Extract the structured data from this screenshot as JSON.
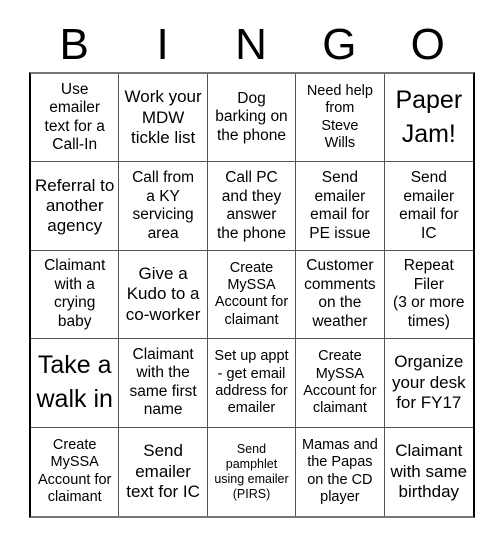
{
  "header": {
    "letters": [
      "B",
      "I",
      "N",
      "G",
      "O"
    ]
  },
  "cells": [
    {
      "text": "Use\nemailer\ntext for a\nCall-In",
      "size": "s15"
    },
    {
      "text": "Work your\nMDW\ntickle list",
      "size": "s17"
    },
    {
      "text": "Dog\nbarking on\nthe phone",
      "size": "s15"
    },
    {
      "text": "Need help\nfrom\nSteve\nWills",
      "size": "s14"
    },
    {
      "text": "Paper\nJam!",
      "size": "s25"
    },
    {
      "text": "Referral to\nanother\nagency",
      "size": "s17"
    },
    {
      "text": "Call from\na KY\nservicing\narea",
      "size": "s15"
    },
    {
      "text": "Call PC\nand they\nanswer\nthe phone",
      "size": "s15"
    },
    {
      "text": "Send\nemailer\nemail for\nPE issue",
      "size": "s15"
    },
    {
      "text": "Send\nemailer\nemail for\nIC",
      "size": "s15"
    },
    {
      "text": "Claimant\nwith a\ncrying\nbaby",
      "size": "s15"
    },
    {
      "text": "Give a\nKudo to a\nco-worker",
      "size": "s17"
    },
    {
      "text": "Create\nMySSA\nAccount for\nclaimant",
      "size": "s14"
    },
    {
      "text": "Customer\ncomments\non the\nweather",
      "size": "s15"
    },
    {
      "text": "Repeat\nFiler\n(3 or more\ntimes)",
      "size": "s15"
    },
    {
      "text": "Take a\nwalk in",
      "size": "s25"
    },
    {
      "text": "Claimant\nwith the\nsame first\nname",
      "size": "s15"
    },
    {
      "text": "Set up appt\n- get email\naddress for\nemailer",
      "size": "s14"
    },
    {
      "text": "Create\nMySSA\nAccount for\nclaimant",
      "size": "s14"
    },
    {
      "text": "Organize\nyour desk\nfor FY17",
      "size": "s17"
    },
    {
      "text": "Create\nMySSA\nAccount for\nclaimant",
      "size": "s14"
    },
    {
      "text": "Send\nemailer\ntext for IC",
      "size": "s17"
    },
    {
      "text": "Send\npamphlet\nusing emailer\n(PIRS)",
      "size": "s12"
    },
    {
      "text": "Mamas and\nthe Papas\non the CD\nplayer",
      "size": "s14"
    },
    {
      "text": "Claimant\nwith same\nbirthday",
      "size": "s17"
    }
  ]
}
